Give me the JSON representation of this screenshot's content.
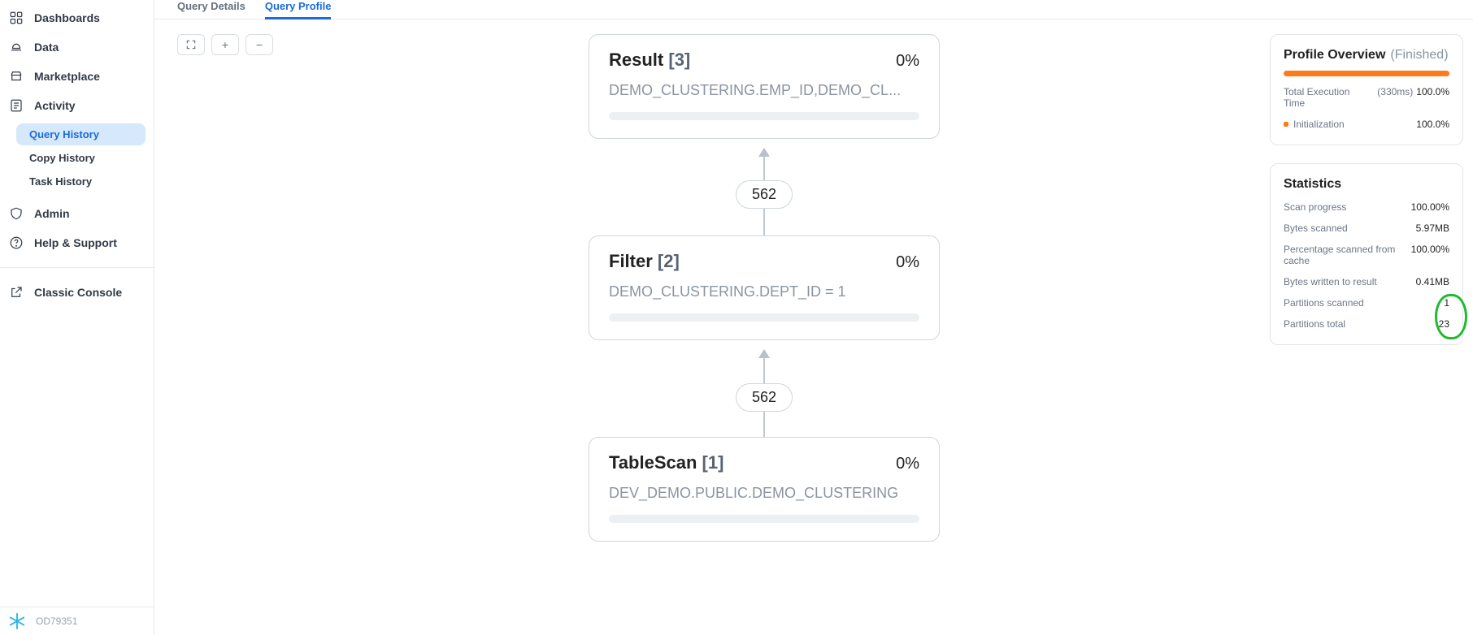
{
  "sidebar": {
    "items": [
      {
        "label": "Dashboards"
      },
      {
        "label": "Data"
      },
      {
        "label": "Marketplace"
      },
      {
        "label": "Activity"
      }
    ],
    "activity_sub": [
      {
        "label": "Query History"
      },
      {
        "label": "Copy History"
      },
      {
        "label": "Task History"
      }
    ],
    "admin_label": "Admin",
    "help_label": "Help & Support",
    "classic_label": "Classic Console",
    "footer_text": "OD79351"
  },
  "tabs": {
    "details": "Query Details",
    "profile": "Query Profile"
  },
  "controls": {
    "fit": "⛶",
    "plus": "+",
    "minus": "−"
  },
  "graph": {
    "nodes": {
      "result": {
        "name": "Result",
        "idx": "[3]",
        "pct": "0%",
        "sub": "DEMO_CLUSTERING.EMP_ID,DEMO_CL..."
      },
      "filter": {
        "name": "Filter",
        "idx": "[2]",
        "pct": "0%",
        "sub": "DEMO_CLUSTERING.DEPT_ID = 1"
      },
      "tablescan": {
        "name": "TableScan",
        "idx": "[1]",
        "pct": "0%",
        "sub": "DEV_DEMO.PUBLIC.DEMO_CLUSTERING"
      }
    },
    "edge_count_1": "562",
    "edge_count_2": "562"
  },
  "overview": {
    "title": "Profile Overview",
    "status": "(Finished)",
    "total_exec_label": "Total Execution Time",
    "total_exec_time": "(330ms)",
    "total_exec_pct": "100.0%",
    "init_label": "Initialization",
    "init_pct": "100.0%"
  },
  "stats": {
    "title": "Statistics",
    "rows": [
      {
        "k": "Scan progress",
        "v": "100.00%"
      },
      {
        "k": "Bytes scanned",
        "v": "5.97MB"
      },
      {
        "k": "Percentage scanned from cache",
        "v": "100.00%"
      },
      {
        "k": "Bytes written to result",
        "v": "0.41MB"
      },
      {
        "k": "Partitions scanned",
        "v": "1"
      },
      {
        "k": "Partitions total",
        "v": "23"
      }
    ]
  }
}
